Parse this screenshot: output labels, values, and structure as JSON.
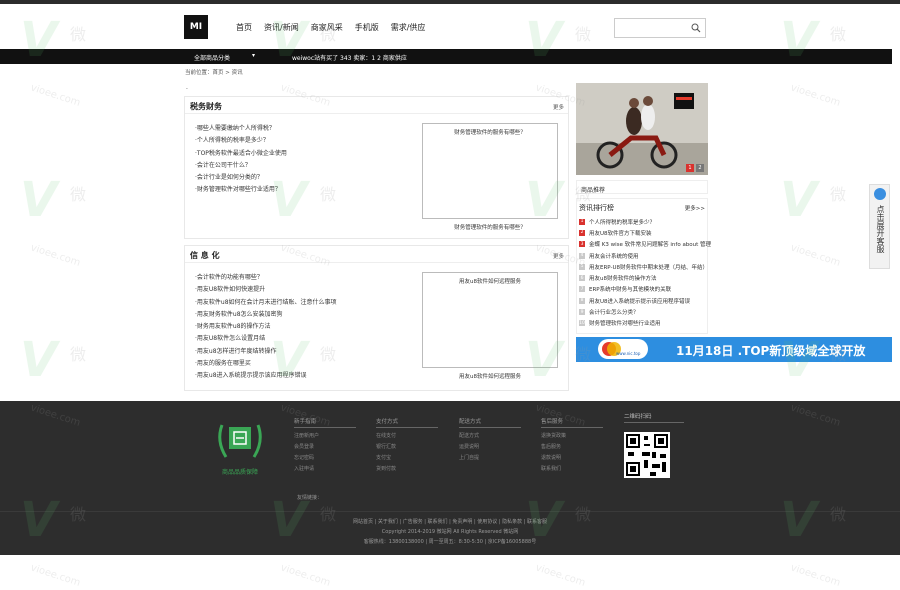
{
  "header": {
    "logo": "MI",
    "nav": [
      "首页",
      "资讯/新闻",
      "商家风采",
      "手机版",
      "需求/供应"
    ],
    "search_placeholder": ""
  },
  "subbar": {
    "category": "全部商品分类",
    "caret": "▾",
    "stats": "weiwoc站有买了 343  卖家：1 2 商家供应"
  },
  "breadcrumb": "当前位置：首页 > 资讯",
  "dot": "·",
  "finance": {
    "title": "税务财务",
    "more": "更多",
    "items": [
      "·哪些人需要缴纳个人所得税？",
      "·个人所得税的税率是多少？",
      "·TOP税务软件最适合小微企业使用",
      "·会计在公司干什么？",
      "·会计行业是如何分类的？",
      "·财务管理软件对哪些行业适用？"
    ],
    "img_alt": "财务管理软件的服务有哪些？",
    "caption": "财务管理软件的服务有哪些？"
  },
  "info": {
    "title": "信 息 化",
    "more": "更多",
    "items": [
      "·会计软件的功能有哪些？",
      "·用友U8软件如何快速提升",
      "·用友软件u8如何在会计月末进行结账、注意什么事项",
      "·用友财务软件u8怎么安装加密狗",
      "·财务用友软件u8的操作方法",
      "·用友U8软件怎么设置月结",
      "·用友u8怎样进行年度结转操作",
      "·用友的服务在哪里买",
      "·用友u8进入系统提示提示该应用程序错误"
    ],
    "img_alt": "用友u8软件如何远程服务",
    "caption": "用友u8软件如何远程服务"
  },
  "banner": {
    "pager": [
      "1",
      "2"
    ]
  },
  "products_title": "商品推荐",
  "ranking": {
    "title": "资讯排行榜",
    "more": "更多>>",
    "items": [
      {
        "n": "1",
        "text": "个人所得税的税率是多少？",
        "hot": true
      },
      {
        "n": "2",
        "text": "用友U8软件官方下载安装",
        "hot": true
      },
      {
        "n": "3",
        "text": "金蝶 K3 wise 软件常见问题解答 info about 管理",
        "hot": true
      },
      {
        "n": "4",
        "text": "用友会计系统的使用",
        "hot": false
      },
      {
        "n": "5",
        "text": "用友ERP-U8财务软件中期末处理（月结、年结）",
        "hot": false
      },
      {
        "n": "6",
        "text": "用友u8财务软件的操作方法",
        "hot": false
      },
      {
        "n": "7",
        "text": "ERP系统中财务与其他模块的关联",
        "hot": false
      },
      {
        "n": "8",
        "text": "用友U8进入系统提示提示该应用程序错误",
        "hot": false
      },
      {
        "n": "9",
        "text": "会计行业怎么分类？",
        "hot": false
      },
      {
        "n": "10",
        "text": "财务管理软件对哪些行业适用",
        "hot": false
      }
    ]
  },
  "ad": {
    "site": "www.nic.top",
    "text": "11月18日 .TOP新顶级域全球开放"
  },
  "side_float": "点击展开客服",
  "footer": {
    "badge_text": "商品品质保障",
    "columns": [
      {
        "head": "新手指南",
        "items": [
          "注册新用户",
          "会员登录",
          "忘记密码",
          "入驻申请"
        ]
      },
      {
        "head": "支付方式",
        "items": [
          "在线支付",
          "银行汇款",
          "支付宝",
          "货到付款"
        ]
      },
      {
        "head": "配送方式",
        "items": [
          "配送方式",
          "运费说明",
          "上门自提"
        ]
      },
      {
        "head": "售后服务",
        "items": [
          "退换货政策",
          "售后服务",
          "退款说明",
          "联系我们"
        ]
      }
    ],
    "qr_head": "二维码扫码",
    "links_label": "友情链接：",
    "bottom_links": "网站首页 | 关于我们 | 广告服务 | 联系我们 | 免责声明 | 使用协议 | 隐私条款 | 联系客服",
    "copyright": "Copyright 2014-2019 微站网 All Rights Reserved 微站网",
    "contact": "客服热线：13800138000 | 周一至周五：8:30-5:30 | 京ICP备16005888号"
  },
  "watermark": {
    "letter": "V",
    "char": "微",
    "url": "vioee.com"
  },
  "colors": {
    "accent_red": "#d9322e",
    "footer_bg": "#2d2d2d",
    "badge_green": "#3aa655",
    "ad_blue": "#2d8ee0"
  }
}
